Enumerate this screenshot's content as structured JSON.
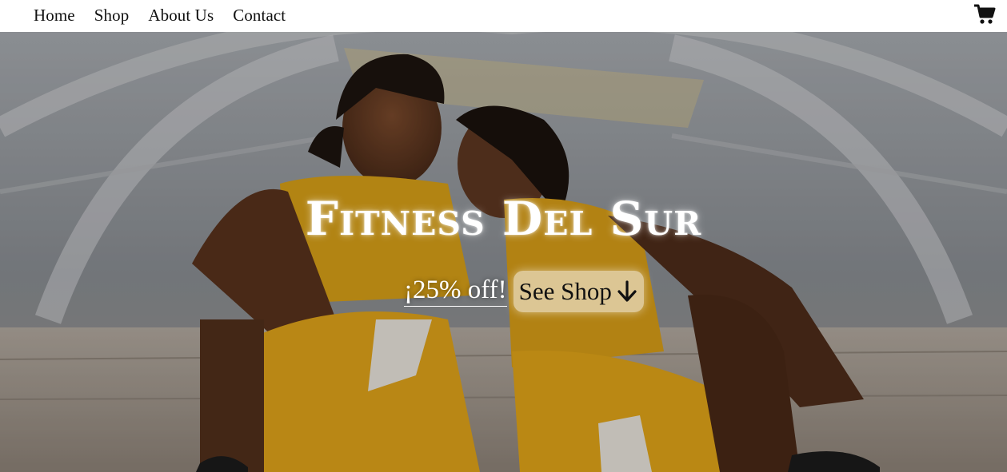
{
  "nav": {
    "links": [
      {
        "label": "Home"
      },
      {
        "label": "Shop"
      },
      {
        "label": "About Us"
      },
      {
        "label": "Contact"
      }
    ],
    "cart_icon": "shopping-cart-icon"
  },
  "hero": {
    "title": "Fitness Del Sur",
    "promo": "¡25% off!",
    "cta_label": "See Shop",
    "cta_icon": "arrow-down-icon",
    "image_description_colors": {
      "outfit": "#e0a51c",
      "background": "#8e9296"
    }
  }
}
